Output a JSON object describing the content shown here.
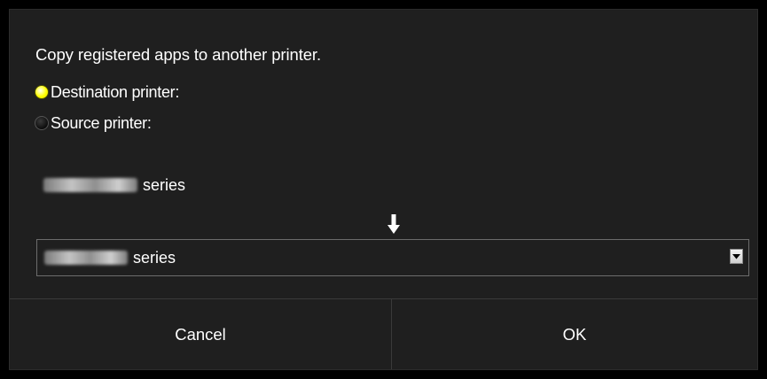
{
  "dialog": {
    "heading": "Copy registered apps to another printer.",
    "radios": [
      {
        "label": "Destination printer:",
        "selected": true
      },
      {
        "label": "Source printer:",
        "selected": false
      }
    ],
    "source_printer": {
      "suffix": "series"
    },
    "arrow_icon": "arrow-down-icon",
    "destination_select": {
      "value_suffix": "series",
      "icon": "dropdown-arrow-icon"
    },
    "buttons": {
      "cancel_label": "Cancel",
      "ok_label": "OK"
    }
  },
  "colors": {
    "background": "#1f1f1f",
    "frame": "#000000",
    "text": "#ffffff",
    "radio_selected": "#ffff00",
    "divider": "#3a3a3a",
    "select_border": "#6c6c6c"
  }
}
